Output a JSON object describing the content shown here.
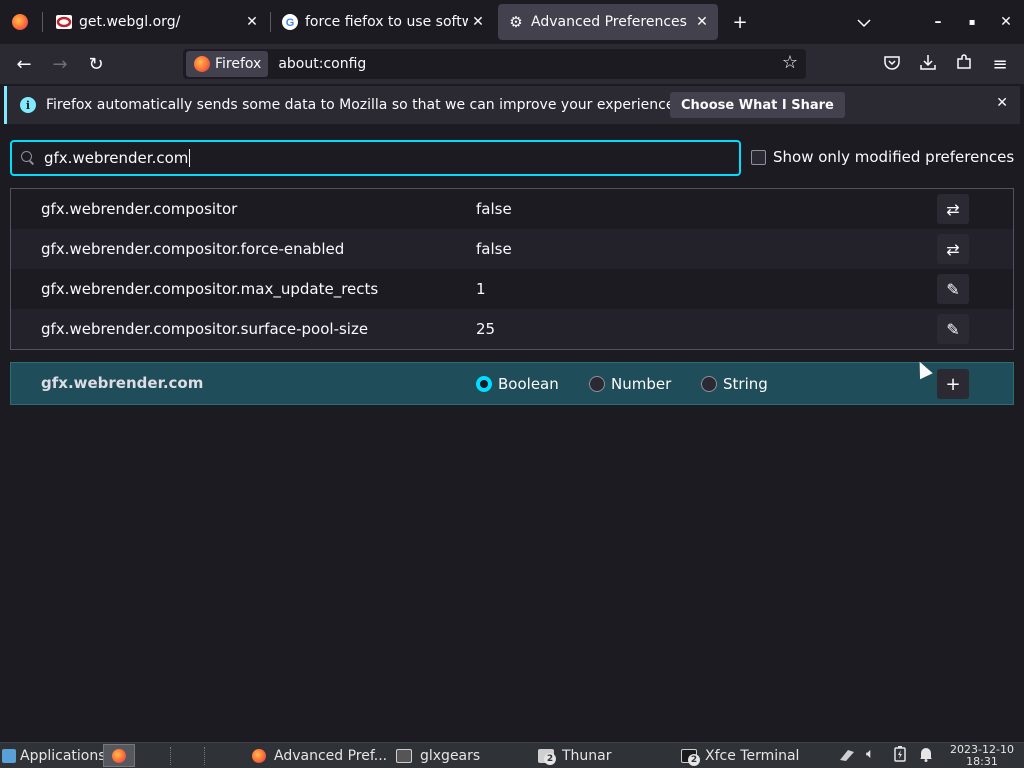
{
  "tabs": [
    {
      "title": "get.webgl.org/",
      "favicon": "webgl-icon",
      "selected": false
    },
    {
      "title": "force fiefox to use software",
      "favicon": "google-icon",
      "selected": false
    },
    {
      "title": "Advanced Preferences",
      "favicon": "gear-icon",
      "selected": true
    }
  ],
  "new_tab_symbol": "+",
  "list_all_tabs_symbol": "⌄",
  "window_controls": {
    "minimize": "–",
    "maximize": "▪",
    "close": "✕"
  },
  "nav": {
    "back": "←",
    "forward": "→",
    "reload": "↻",
    "identity_label": "Firefox",
    "url": "about:config",
    "bookmark_star": "☆",
    "pocket": "♡",
    "downloads": "⤓",
    "extensions": "⧉",
    "menu": "≡"
  },
  "notification": {
    "message": "Firefox automatically sends some data to Mozilla so that we can improve your experience.",
    "button": "Choose What I Share",
    "info_symbol": "i",
    "close": "✕"
  },
  "config": {
    "search_value": "gfx.webrender.com",
    "show_modified_label": "Show only modified preferences",
    "show_modified_checked": false,
    "prefs": [
      {
        "name": "gfx.webrender.compositor",
        "value": "false",
        "action": "toggle",
        "action_symbol": "⇄"
      },
      {
        "name": "gfx.webrender.compositor.force-enabled",
        "value": "false",
        "action": "toggle",
        "action_symbol": "⇄"
      },
      {
        "name": "gfx.webrender.compositor.max_update_rects",
        "value": "1",
        "action": "edit",
        "action_symbol": "✎"
      },
      {
        "name": "gfx.webrender.compositor.surface-pool-size",
        "value": "25",
        "action": "edit",
        "action_symbol": "✎"
      }
    ],
    "new_pref": {
      "name": "gfx.webrender.com",
      "types": [
        "Boolean",
        "Number",
        "String"
      ],
      "selected_type": "Boolean",
      "add_symbol": "+"
    }
  },
  "taskbar": {
    "applications": "Applications",
    "tasks": [
      {
        "label": "Advanced Pref...",
        "icon": "firefox-icon"
      },
      {
        "label": "glxgears",
        "icon": "window-icon"
      },
      {
        "label": "Thunar",
        "icon": "folder-icon",
        "badge": "2"
      },
      {
        "label": "Xfce Terminal",
        "icon": "terminal-icon",
        "badge": "2"
      }
    ],
    "date": "2023-12-10",
    "time": "18:31"
  }
}
